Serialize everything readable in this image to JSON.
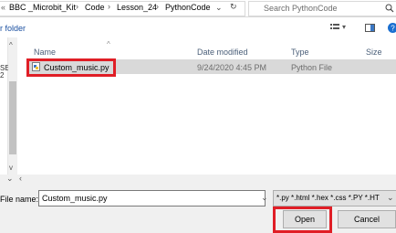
{
  "address": {
    "prefix": "«",
    "crumbs": [
      "BBC _Microbit_Kit",
      "Code",
      "Lesson_24",
      "PythonCode"
    ],
    "separator": "›",
    "dropdown": "⌄",
    "refresh": "↻"
  },
  "search": {
    "placeholder": "Search PythonCode",
    "icon": "search-icon"
  },
  "toolbar": {
    "new_folder_label": "r folder"
  },
  "columns": {
    "name": "Name",
    "date": "Date modified",
    "type": "Type",
    "size": "Size"
  },
  "files": [
    {
      "name": "Custom_music.py",
      "date": "9/24/2020 4:45 PM",
      "type": "Python File",
      "size": ""
    }
  ],
  "left_nav_fragments": [
    "SE",
    "2"
  ],
  "bottom": {
    "file_name_label": "File name:",
    "file_name_value": "Custom_music.py",
    "filter_value": "*.py *.html *.hex *.css *.PY *.HT",
    "open_label": "Open",
    "cancel_label": "Cancel"
  },
  "colors": {
    "highlight": "#e01e26",
    "selected_row": "#d9d9d9",
    "link": "#1a4fa0"
  }
}
